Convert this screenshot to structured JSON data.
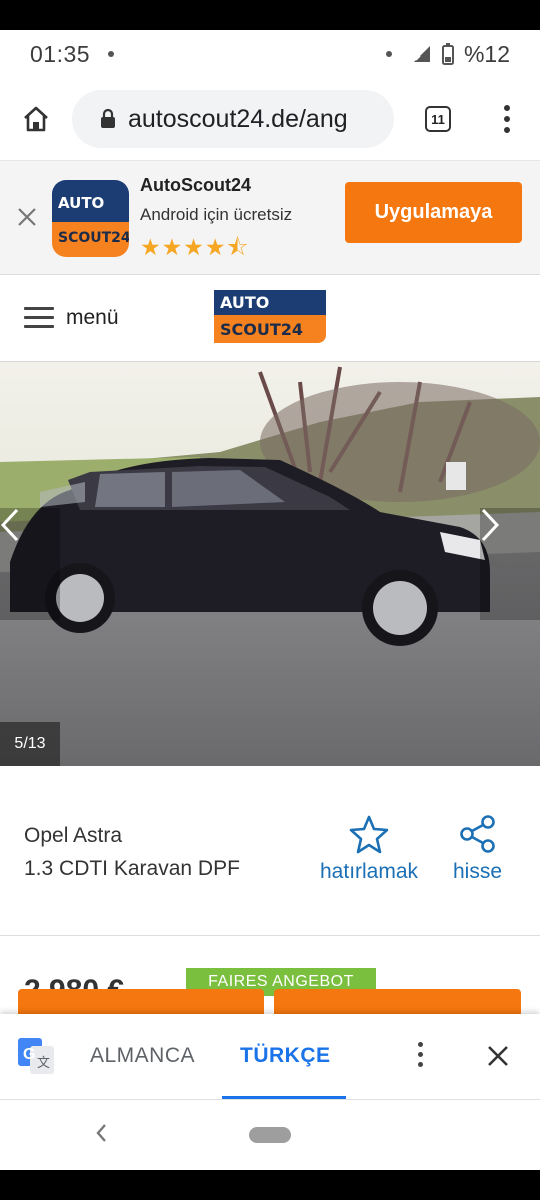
{
  "status_bar": {
    "time": "01:35",
    "battery": "%12"
  },
  "browser": {
    "url": "autoscout24.de/ang",
    "tab_count": "11"
  },
  "app_banner": {
    "app_name": "AutoScout24",
    "subtitle": "Android için ücretsiz",
    "rating_stars": "★★★★⯪",
    "rating": 4.5,
    "install_label": "Uygulamaya",
    "logo_top": "AUTO",
    "logo_bottom": "SCOUT24"
  },
  "header": {
    "menu_label": "menü",
    "logo_top": "AUTO",
    "logo_bottom": "SCOUT24"
  },
  "gallery": {
    "counter": "5/13"
  },
  "listing": {
    "make": "Opel Astra",
    "model": "1.3 CDTI Karavan DPF",
    "remember_label": "hatırlamak",
    "share_label": "hisse",
    "price": "2.980 €",
    "badge": "FAIRES ANGEBOT"
  },
  "translate_bar": {
    "source_lang": "ALMANCA",
    "target_lang": "TÜRKÇE"
  },
  "colors": {
    "brand_orange": "#f5770f",
    "brand_navy": "#1b3d73",
    "link_blue": "#1a6fb5",
    "translate_blue": "#1a73e8",
    "badge_green": "#7bbf3f"
  }
}
